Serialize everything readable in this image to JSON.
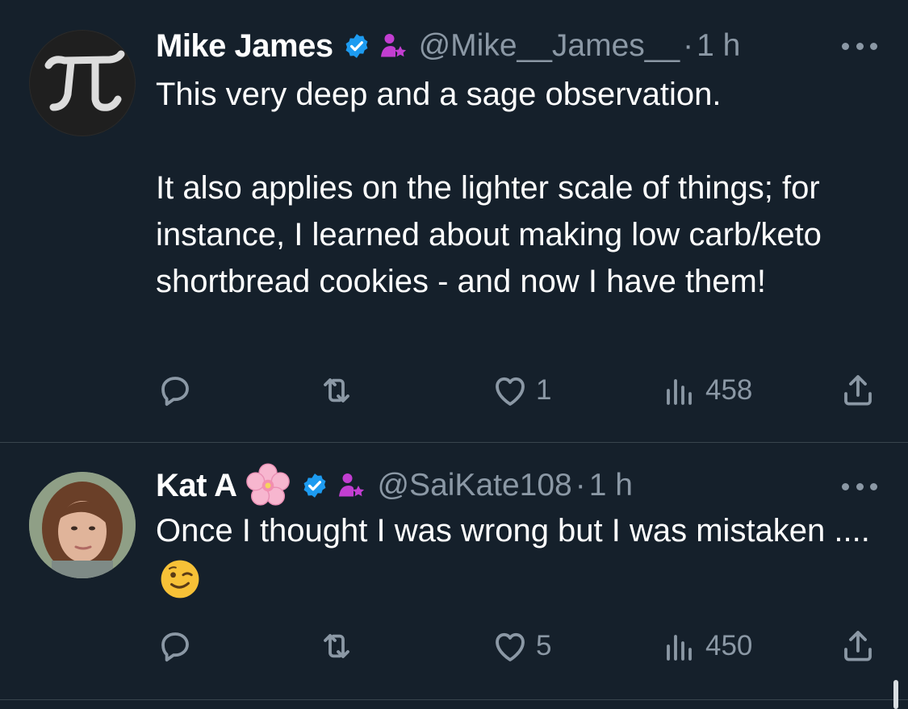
{
  "tweets": [
    {
      "name": "Mike James",
      "handle": "@Mike__James__",
      "separator": "·",
      "time": "1 h",
      "text": "This very deep and a sage observation.\n\nIt also applies on the lighter scale of things; for instance, I learned about making low carb/keto shortbread cookies - and now I have them!",
      "avatar_symbol": "π",
      "likes": "1",
      "views": "458"
    },
    {
      "name": "Kat A",
      "handle": "@SaiKate108",
      "separator": "·",
      "time": "1 h",
      "text": "Once I thought I was wrong but I was mistaken ....",
      "likes": "5",
      "views": "450"
    }
  ],
  "icons": {
    "verified": "verified-badge-icon",
    "affiliate": "affiliate-person-star-icon",
    "flower": "cherry-blossom-emoji",
    "wink": "winking-face-emoji",
    "reply": "reply-icon",
    "retweet": "retweet-icon",
    "like": "heart-icon",
    "views": "views-icon",
    "share": "share-icon",
    "more": "more-options-icon"
  },
  "colors": {
    "background": "#15202b",
    "text": "#ffffff",
    "muted": "#8b98a5",
    "verified": "#1d9bf0",
    "affiliate": "#c23ed1",
    "divider": "#38444d"
  }
}
